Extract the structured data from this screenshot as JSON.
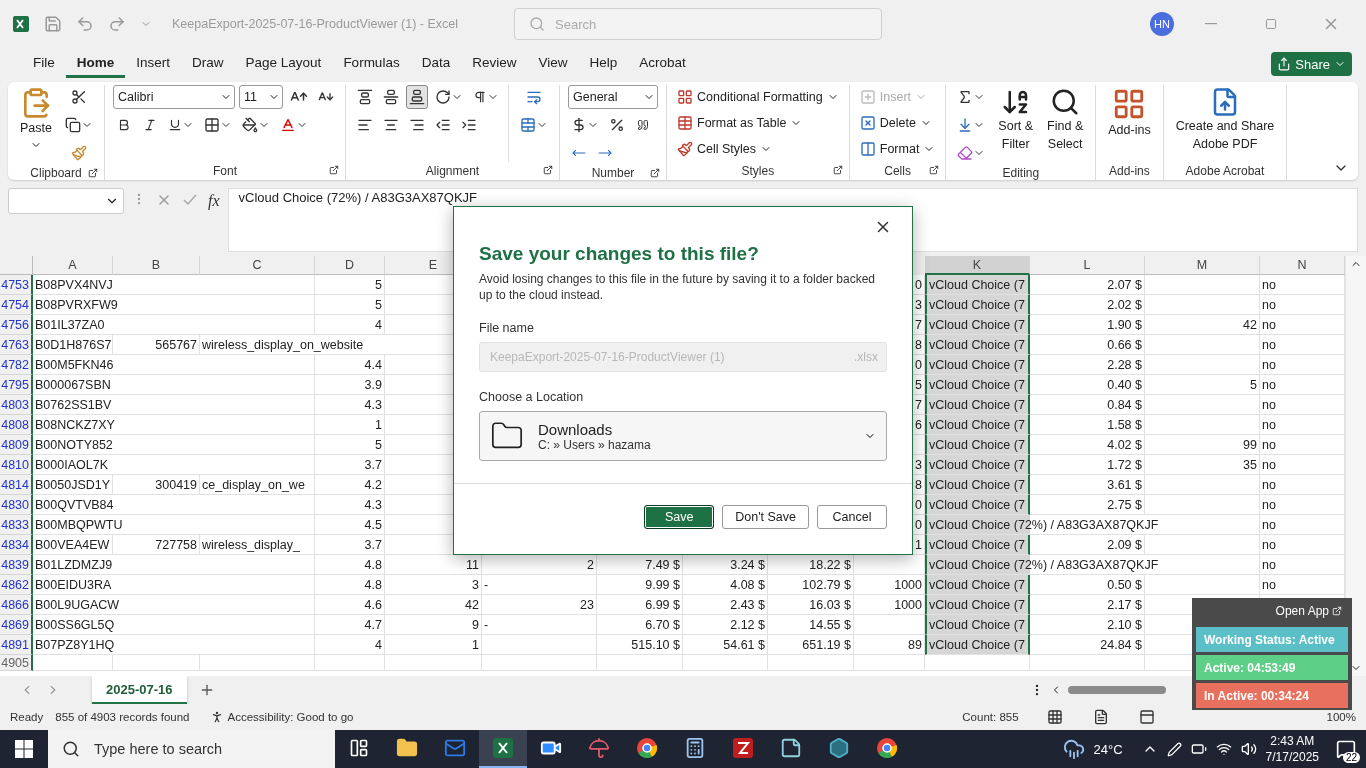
{
  "window": {
    "title": "KeepaExport-2025-07-16-ProductViewer (1)  -  Excel",
    "search_placeholder": "Search",
    "avatar": "HN"
  },
  "menu_tabs": [
    {
      "label": "File",
      "selected": false
    },
    {
      "label": "Home",
      "selected": true
    },
    {
      "label": "Insert",
      "selected": false
    },
    {
      "label": "Draw",
      "selected": false
    },
    {
      "label": "Page Layout",
      "selected": false
    },
    {
      "label": "Formulas",
      "selected": false
    },
    {
      "label": "Data",
      "selected": false
    },
    {
      "label": "Review",
      "selected": false
    },
    {
      "label": "View",
      "selected": false
    },
    {
      "label": "Help",
      "selected": false
    },
    {
      "label": "Acrobat",
      "selected": false
    }
  ],
  "share": "Share",
  "ribbon_groups": [
    {
      "kind": "clipboard",
      "label": "Clipboard",
      "paste": "Paste"
    },
    {
      "kind": "font",
      "label": "Font",
      "font_name": "Calibri",
      "font_size": "11"
    },
    {
      "kind": "alignment",
      "label": "Alignment",
      "vertical": [
        {
          "kind": "top",
          "selected": false
        },
        {
          "kind": "middle",
          "selected": false
        },
        {
          "kind": "bottom",
          "selected": true
        }
      ]
    },
    {
      "kind": "number",
      "label": "Number",
      "format": "General"
    },
    {
      "kind": "styles",
      "label": "Styles",
      "items": [
        "Conditional Formatting",
        "Format as Table",
        "Cell Styles"
      ]
    },
    {
      "kind": "cells",
      "label": "Cells",
      "items": [
        {
          "label": "Insert",
          "disabled": true
        },
        {
          "label": "Delete",
          "disabled": false
        },
        {
          "label": "Format",
          "disabled": false
        }
      ]
    },
    {
      "kind": "editing",
      "label": "Editing",
      "items": [
        {
          "kind": "sort",
          "lines": [
            "Sort &",
            "Filter"
          ]
        },
        {
          "kind": "find",
          "lines": [
            "Find &",
            "Select"
          ]
        }
      ]
    },
    {
      "kind": "addins",
      "label": "Add-ins",
      "button": "Add-ins"
    },
    {
      "kind": "acrobat",
      "label": "Adobe Acrobat",
      "lines": [
        "Create and Share",
        "Adobe PDF"
      ]
    }
  ],
  "formula_bar": {
    "fx": "fx",
    "formula": "vCloud Choice (72%) / A83G3AX87QKJF"
  },
  "grid": {
    "columns": [
      {
        "label": "A",
        "kind": "text",
        "selected": false
      },
      {
        "label": "B",
        "kind": "number",
        "selected": false
      },
      {
        "label": "C",
        "kind": "text",
        "selected": false
      },
      {
        "label": "D",
        "kind": "number",
        "selected": false
      },
      {
        "label": "E",
        "kind": "number",
        "selected": false
      },
      {
        "kind": "number"
      },
      {
        "kind": "number"
      },
      {
        "kind": "number"
      },
      {
        "kind": "number"
      },
      {
        "kind": "number"
      },
      {
        "label": "K",
        "kind": "text",
        "selected": true
      },
      {
        "label": "L",
        "kind": "number",
        "selected": false
      },
      {
        "label": "M",
        "kind": "number",
        "selected": false
      },
      {
        "label": "N",
        "kind": "text",
        "selected": false
      }
    ],
    "rows": [
      {
        "header": "4753",
        "filtered": true,
        "cells": [
          "B08PVX4NVJ",
          null,
          null,
          "5",
          null,
          null,
          null,
          null,
          null,
          "0",
          "vCloud Choice (7",
          "2.07 $",
          null,
          "no"
        ]
      },
      {
        "header": "4754",
        "filtered": true,
        "cells": [
          "B08PVRXFW9",
          null,
          null,
          "5",
          null,
          null,
          null,
          null,
          null,
          "3",
          "vCloud Choice (7",
          "2.02 $",
          null,
          "no"
        ]
      },
      {
        "header": "4756",
        "filtered": true,
        "cells": [
          "B01IL37ZA0",
          null,
          null,
          "4",
          null,
          null,
          null,
          null,
          null,
          "7",
          "vCloud Choice (7",
          "1.90 $",
          "42",
          "no"
        ]
      },
      {
        "header": "4763",
        "filtered": true,
        "cells": [
          "B0D1H876S7",
          "565767",
          "wireless_display_on_website",
          null,
          null,
          null,
          null,
          null,
          null,
          "8",
          "vCloud Choice (7",
          "0.66 $",
          null,
          "no"
        ]
      },
      {
        "header": "4782",
        "filtered": true,
        "cells": [
          "B00M5FKN46",
          null,
          null,
          "4.4",
          null,
          null,
          null,
          null,
          null,
          "0",
          "vCloud Choice (7",
          "2.28 $",
          null,
          "no"
        ]
      },
      {
        "header": "4795",
        "filtered": true,
        "cells": [
          "B000067SBN",
          null,
          null,
          "3.9",
          null,
          null,
          null,
          null,
          null,
          "5",
          "vCloud Choice (7",
          "0.40 $",
          "5",
          "no"
        ]
      },
      {
        "header": "4803",
        "filtered": true,
        "cells": [
          "B0762SS1BV",
          null,
          null,
          "4.3",
          null,
          null,
          null,
          null,
          null,
          "7",
          "vCloud Choice (7",
          "0.84 $",
          null,
          "no"
        ]
      },
      {
        "header": "4808",
        "filtered": true,
        "cells": [
          "B08NCKZ7XY",
          null,
          null,
          "1",
          null,
          null,
          null,
          null,
          null,
          "6",
          "vCloud Choice (7",
          "1.58 $",
          null,
          "no"
        ]
      },
      {
        "header": "4809",
        "filtered": true,
        "cells": [
          "B00NOTY852",
          null,
          null,
          "5",
          null,
          null,
          null,
          null,
          null,
          null,
          "vCloud Choice (7",
          "4.02 $",
          "99",
          "no"
        ]
      },
      {
        "header": "4810",
        "filtered": true,
        "cells": [
          "B000IAOL7K",
          null,
          null,
          "3.7",
          null,
          null,
          null,
          null,
          null,
          "3",
          "vCloud Choice (7",
          "1.72 $",
          "35",
          "no"
        ]
      },
      {
        "header": "4814",
        "filtered": true,
        "cells": [
          "B0050JSD1Y",
          "300419",
          "ce_display_on_we",
          "4.2",
          null,
          null,
          null,
          null,
          null,
          "8",
          "vCloud Choice (7",
          "3.61 $",
          null,
          "no"
        ]
      },
      {
        "header": "4830",
        "filtered": true,
        "cells": [
          "B00QVTVB84",
          null,
          null,
          "4.3",
          null,
          null,
          null,
          null,
          null,
          "0",
          "vCloud Choice (7",
          "2.75 $",
          null,
          "no"
        ]
      },
      {
        "header": "4833",
        "filtered": true,
        "cells": [
          "B00MBQPWTU",
          null,
          null,
          "4.5",
          null,
          null,
          null,
          null,
          null,
          "0",
          "vCloud Choice (72%) / A83G3AX87QKJF",
          null,
          null,
          "no"
        ]
      },
      {
        "header": "4834",
        "filtered": true,
        "cells": [
          "B00VEA4EW",
          "727758",
          "wireless_display_",
          "3.7",
          null,
          null,
          null,
          null,
          null,
          "1",
          "vCloud Choice (7",
          "2.09 $",
          null,
          "no"
        ]
      },
      {
        "header": "4839",
        "filtered": true,
        "cells": [
          "B01LZDMZJ9",
          null,
          null,
          "4.8",
          "11",
          "2",
          "7.49 $",
          "3.24 $",
          "18.22 $",
          null,
          "vCloud Choice (72%) / A83G3AX87QKJF",
          null,
          null,
          "no"
        ]
      },
      {
        "header": "4862",
        "filtered": true,
        "cells": [
          "B00EIDU3RA",
          null,
          null,
          "4.8",
          "3",
          {
            "text": "-",
            "kind": "text"
          },
          "9.99 $",
          "4.08 $",
          "102.79 $",
          "1000",
          "vCloud Choice (7",
          "0.50 $",
          null,
          "no"
        ]
      },
      {
        "header": "4866",
        "filtered": true,
        "cells": [
          "B00L9UGACW",
          null,
          null,
          "4.6",
          "42",
          "23",
          "6.99 $",
          "2.43 $",
          "16.03 $",
          "1000",
          "vCloud Choice (7",
          "2.17 $",
          null,
          null
        ]
      },
      {
        "header": "4869",
        "filtered": true,
        "cells": [
          "B00SS6GL5Q",
          null,
          null,
          "4.7",
          "9",
          {
            "text": "-",
            "kind": "text"
          },
          "6.70 $",
          "2.12 $",
          "14.55 $",
          null,
          "vCloud Choice (7",
          "2.10 $",
          null,
          null
        ]
      },
      {
        "header": "4891",
        "filtered": true,
        "cells": [
          "B07PZ8Y1HQ",
          null,
          null,
          "4",
          "1",
          null,
          "515.10 $",
          "54.61 $",
          "651.19 $",
          "89",
          "vCloud Choice (7",
          "24.84 $",
          null,
          null
        ]
      },
      {
        "header": "4905",
        "filtered": false
      }
    ]
  },
  "dialog": {
    "title": "Save your changes to this file?",
    "description": "Avoid losing changes to this file in the future by saving it to a folder backed up to the cloud instead.",
    "file_name_label": "File name",
    "file_name": "KeepaExport-2025-07-16-ProductViewer (1)",
    "extension": ".xlsx",
    "location_label": "Choose a Location",
    "location": "Downloads",
    "path": "C: » Users » hazama",
    "buttons": [
      {
        "label": "Save",
        "kind": "primary"
      },
      {
        "label": "Don't Save",
        "kind": "secondary"
      },
      {
        "label": "Cancel",
        "kind": "secondary"
      }
    ]
  },
  "tracker": {
    "open_app": "Open App",
    "items": [
      {
        "text": "Working Status: Active",
        "color": "#5bbfc8"
      },
      {
        "text": "Active: 04:53:49",
        "color": "#5dcf86"
      },
      {
        "text": "In Active: 00:34:24",
        "color": "#e8705f"
      }
    ]
  },
  "sheet_tabs": [
    {
      "label": "2025-07-16",
      "selected": true
    }
  ],
  "status_bar": {
    "mode": "Ready",
    "records": "855 of 4903 records found",
    "accessibility": "Accessibility: Good to go",
    "count": "Count: 855",
    "zoom": "100%"
  },
  "taskbar": {
    "search_placeholder": "Type here to search",
    "apps": [
      {
        "kind": "taskview",
        "selected": false
      },
      {
        "kind": "explorer",
        "selected": false
      },
      {
        "kind": "outlook",
        "selected": false
      },
      {
        "kind": "excel",
        "selected": true
      },
      {
        "kind": "zoom",
        "selected": false
      },
      {
        "kind": "umbrella",
        "selected": false
      },
      {
        "kind": "chrome",
        "selected": false
      },
      {
        "kind": "calculator",
        "selected": false
      },
      {
        "kind": "filezilla",
        "selected": false
      },
      {
        "kind": "notes",
        "selected": false
      },
      {
        "kind": "hexagon",
        "selected": false
      },
      {
        "kind": "chrome",
        "selected": false
      }
    ],
    "temperature": "24°C",
    "time": "2:43 AM",
    "date": "7/17/2025",
    "notifications": "22"
  }
}
